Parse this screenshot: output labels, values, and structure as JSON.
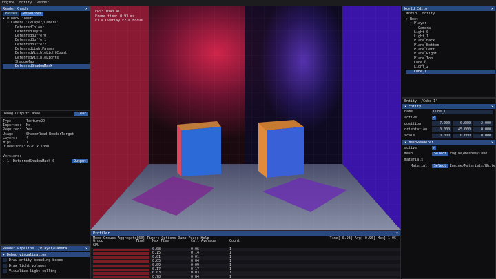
{
  "menu": [
    "Engine",
    "Entity",
    "Render"
  ],
  "render_graph": {
    "title": "Render Graph",
    "tabs": [
      "Passes",
      "Resources"
    ],
    "tree": [
      {
        "label": "▾ Window 'Test'",
        "indent": 0
      },
      {
        "label": "▾ Camera '/Player/Camera'",
        "indent": 1
      },
      {
        "label": "DeferredColour",
        "indent": 3
      },
      {
        "label": "DeferredDepth",
        "indent": 3
      },
      {
        "label": "DeferredBuffer0",
        "indent": 3
      },
      {
        "label": "DeferredBuffer1",
        "indent": 3
      },
      {
        "label": "DeferredBuffer2",
        "indent": 3
      },
      {
        "label": "DeferredLightParams",
        "indent": 3
      },
      {
        "label": "DeferredVisibleLightCount",
        "indent": 3
      },
      {
        "label": "DeferredVisibleLights",
        "indent": 3
      },
      {
        "label": "ShadowMap",
        "indent": 3
      },
      {
        "label": "DeferredShadowMask",
        "indent": 3,
        "selected": true
      }
    ],
    "debug_output_label": "Debug Output: None",
    "clear_label": "Clear",
    "props": [
      {
        "k": "Type:",
        "v": "Texture2D"
      },
      {
        "k": "Imported:",
        "v": "No"
      },
      {
        "k": "Required:",
        "v": "Yes"
      },
      {
        "k": "Usage:",
        "v": "ShaderRead RenderTarget"
      },
      {
        "k": "Layers:",
        "v": "4"
      },
      {
        "k": "Mips:",
        "v": "1"
      },
      {
        "k": "Dimensions:",
        "v": "1920 x 1080"
      }
    ],
    "versions_label": "Versions:",
    "version_item": "▸ 1: DeferredShadowMask_0",
    "output_label": "Output"
  },
  "render_pipeline": {
    "title": "Render Pipeline '/Player/Camera'",
    "section": "▾ Debug visualization",
    "options": [
      "Draw entity bounding boxes",
      "Draw light volumes",
      "Visualize light culling"
    ]
  },
  "viewport": {
    "fps": "FPS: 1040.41",
    "frame_time": "Frame time: 0.93 ms",
    "hint": "F1 = Overlay  F2 = Focus"
  },
  "profiler": {
    "title": "Profiler",
    "menu": "Mode Groups Aggregate[60] Timers Options Dump Pause Help",
    "time_stats": "Time[  0.93] Avg[  0.96] Max[  1.05]",
    "headers": [
      "Group",
      "Timer",
      "Max Time",
      "Call Average",
      "Count"
    ],
    "group0": "GPU",
    "rows": [
      {
        "max": "0.08",
        "avg": "0.06",
        "count": "1"
      },
      {
        "max": "0.15",
        "avg": "0.14",
        "count": "1"
      },
      {
        "max": "0.01",
        "avg": "0.01",
        "count": "1"
      },
      {
        "max": "0.05",
        "avg": "0.04",
        "count": "1"
      },
      {
        "max": "0.09",
        "avg": "0.09",
        "count": "1"
      },
      {
        "max": "0.17",
        "avg": "0.17",
        "count": "1"
      },
      {
        "max": "0.03",
        "avg": "0.03",
        "count": "1"
      },
      {
        "max": "0.78",
        "avg": "0.84",
        "count": "1"
      }
    ]
  },
  "world_editor": {
    "title": "World Editor",
    "tabs": [
      "World",
      "Entity"
    ],
    "tree": [
      {
        "label": "▾ Root",
        "indent": 0
      },
      {
        "label": "▾ Player",
        "indent": 1
      },
      {
        "label": "Camera",
        "indent": 3
      },
      {
        "label": "Light_0",
        "indent": 2
      },
      {
        "label": "Light_1",
        "indent": 2
      },
      {
        "label": "Plane_Back",
        "indent": 2
      },
      {
        "label": "Plane_Bottom",
        "indent": 2
      },
      {
        "label": "Plane_Left",
        "indent": 2
      },
      {
        "label": "Plane_Right",
        "indent": 2
      },
      {
        "label": "Plane_Top",
        "indent": 2
      },
      {
        "label": "Cube_0",
        "indent": 2
      },
      {
        "label": "Light_2",
        "indent": 2
      },
      {
        "label": "Cube_1",
        "indent": 2,
        "selected": true
      }
    ],
    "entity_label": "Entity '/Cube_1'",
    "entity_section": "▾ Entity",
    "name_key": "name",
    "name_val": "Cube_1",
    "active_key": "active",
    "position_key": "position",
    "position": [
      "7.000",
      "0.000",
      "-2.000"
    ],
    "orientation_key": "orientation",
    "orientation": [
      "0.000",
      "45.000",
      "0.000"
    ],
    "scale_key": "scale",
    "scale": [
      "0.000",
      "0.000",
      "0.000"
    ],
    "mesh_section": "▾ MeshRenderer",
    "mesh_active_key": "active",
    "mesh_key": "mesh",
    "select_label": "Select",
    "mesh_val": "Engine/Meshes/Cube",
    "materials_key": "materials",
    "material_key": "Material",
    "material_val": "Engine/Materials/White"
  }
}
